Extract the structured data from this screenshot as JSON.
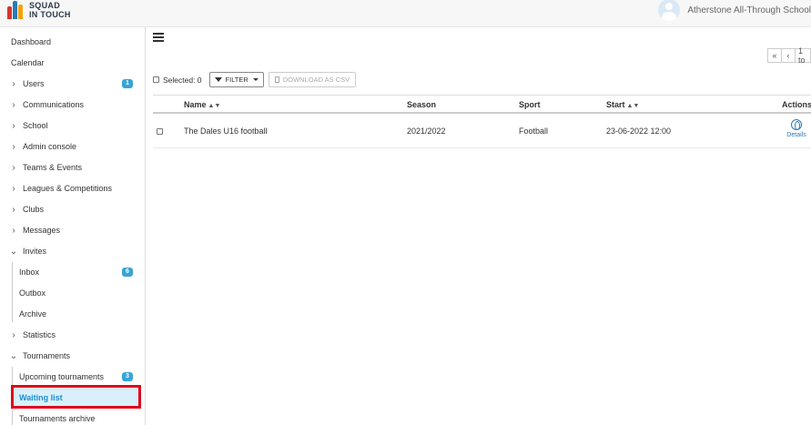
{
  "app": {
    "logo_line1": "SQUAD",
    "logo_line2": "IN TOUCH",
    "org_name": "Atherstone All-Through School"
  },
  "sidebar": {
    "items": [
      {
        "label": "Dashboard",
        "icon": "none"
      },
      {
        "label": "Calendar",
        "icon": "none"
      },
      {
        "label": "Users",
        "icon": "chevron-right-icon",
        "badge": "1"
      },
      {
        "label": "Communications",
        "icon": "chevron-right-icon"
      },
      {
        "label": "School",
        "icon": "chevron-right-icon"
      },
      {
        "label": "Admin console",
        "icon": "chevron-right-icon"
      },
      {
        "label": "Teams & Events",
        "icon": "chevron-right-icon"
      },
      {
        "label": "Leagues & Competitions",
        "icon": "chevron-right-icon"
      },
      {
        "label": "Clubs",
        "icon": "chevron-right-icon"
      },
      {
        "label": "Messages",
        "icon": "chevron-right-icon"
      },
      {
        "label": "Invites",
        "icon": "chevron-down-icon"
      },
      {
        "label": "Inbox",
        "badge": "6"
      },
      {
        "label": "Outbox"
      },
      {
        "label": "Archive"
      },
      {
        "label": "Statistics",
        "icon": "chevron-right-icon"
      },
      {
        "label": "Tournaments",
        "icon": "chevron-down-icon"
      },
      {
        "label": "Upcoming tournaments",
        "badge": "3"
      },
      {
        "label": "Waiting list",
        "active": true
      },
      {
        "label": "Tournaments archive"
      }
    ]
  },
  "pager": {
    "first": "«",
    "prev": "‹",
    "range": "1 to"
  },
  "toolbar": {
    "selected_label": "Selected: 0",
    "filter_label": "FILTER",
    "csv_label": "DOWNLOAD AS CSV"
  },
  "table": {
    "columns": {
      "name": "Name",
      "season": "Season",
      "sport": "Sport",
      "start": "Start",
      "actions": "Actions"
    },
    "rows": [
      {
        "name": "The Dales U16 football",
        "season": "2021/2022",
        "sport": "Football",
        "start": "23-06-2022 12:00",
        "action_label": "Details"
      }
    ]
  },
  "colors": {
    "accent": "#38a4d6",
    "active_text": "#1d8dcf",
    "highlight": "#e0061b"
  }
}
